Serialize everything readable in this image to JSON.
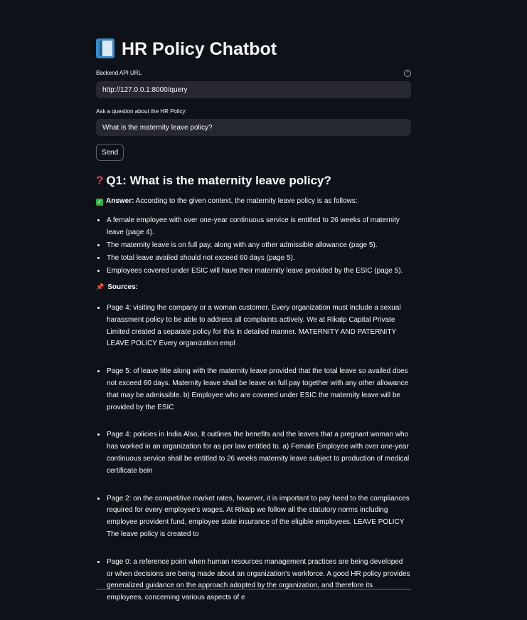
{
  "page": {
    "title": "HR Policy Chatbot",
    "title_icon": "blue-book-icon"
  },
  "form": {
    "api_url_label": "Backend API URL",
    "api_url_value": "http://127.0.0.1:8000/query",
    "question_label": "Ask a question about the HR Policy:",
    "question_value": "What is the maternity leave policy?",
    "send_label": "Send"
  },
  "result": {
    "question_heading": "Q1: What is the maternity leave policy?",
    "answer_label": "Answer:",
    "answer_intro": " According to the given context, the maternity leave policy is as follows:",
    "answer_points": [
      "A female employee with over one-year continuous service is entitled to 26 weeks of maternity leave (page 4).",
      "The maternity leave is on full pay, along with any other admissible allowance (page 5).",
      "The total leave availed should not exceed 60 days (page 5).",
      "Employees covered under ESIC will have their maternity leave provided by the ESIC (page 5)."
    ],
    "sources_label": "Sources:",
    "sources": [
      "Page 4: visiting the company or a woman customer. Every organization must include a sexual harassment policy to be able to address all complaints actively. We at Rikalp Capital Private Limited created a separate policy for this in detailed manner. MATERNITY AND PATERNITY LEAVE POLICY Every organization empl",
      "Page 5: of leave title along with the maternity leave provided that the total leave so availed does not exceed 60 days. Maternity leave shall be leave on full pay together with any other allowance that may be admissible. b) Employee who are covered under ESIC the maternity leave will be provided by the ESIC",
      "Page 4: policies in India Also, It outlines the benefits and the leaves that a pregnant woman who has worked in an organization for as per law entitled to. a) Female Employee with over one-year continuous service shall be entitled to 26 weeks maternity leave subject to production of medical certificate bein",
      "Page 2: on the competitive market rates, however, it is important to pay heed to the compliances required for every employee's wages. At Rikalp we follow all the statutory norms including employee provident fund, employee state insurance of the eligible employees. LEAVE POLICY The leave policy is created to",
      "Page 0: a reference point when human resources management practices are being developed or when decisions are being made about an organization's workforce. A good HR policy provides generalized guidance on the approach adopted by the organization, and therefore its employees, concerning various aspects of e"
    ]
  },
  "colors": {
    "background": "#0e1117",
    "input_bg": "#262730",
    "text": "#fafafa"
  }
}
